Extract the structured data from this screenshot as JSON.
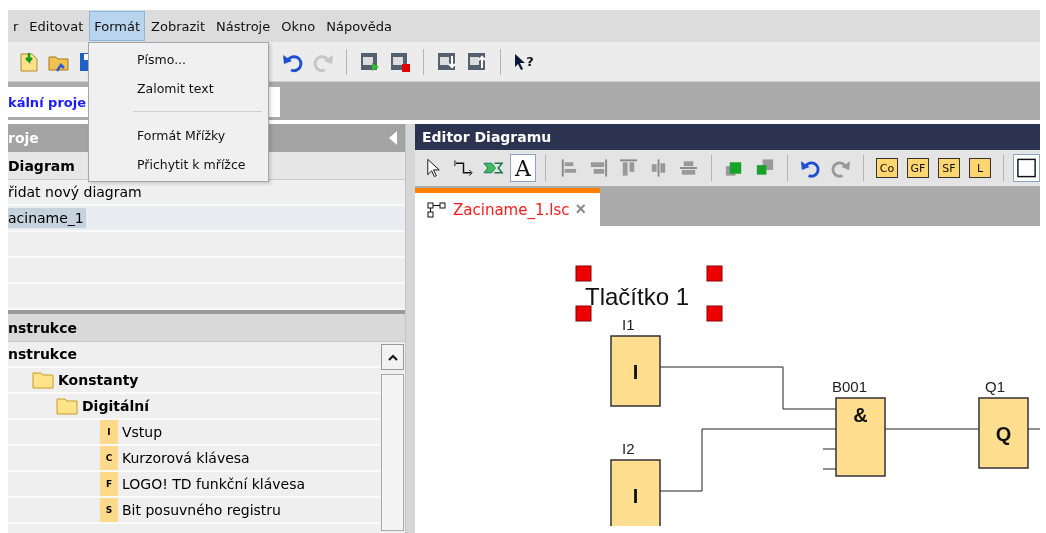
{
  "menu_bar": [
    {
      "label": "r",
      "selected": false
    },
    {
      "label": "Editovat",
      "selected": false
    },
    {
      "label": "Formát",
      "selected": true
    },
    {
      "label": "Zobrazit",
      "selected": false
    },
    {
      "label": "Nástroje",
      "selected": false
    },
    {
      "label": "Okno",
      "selected": false
    },
    {
      "label": "Nápověda",
      "selected": false
    }
  ],
  "format_menu": [
    {
      "kind": "item",
      "label": "Písmo..."
    },
    {
      "kind": "item",
      "label": "Zalomit text"
    },
    {
      "kind": "separator"
    },
    {
      "kind": "item",
      "label": "Formát Mřížky"
    },
    {
      "kind": "item",
      "label": "Přichytit k mřížce"
    }
  ],
  "main_toolbar": [
    {
      "kind": "icon",
      "enabled": true
    },
    {
      "kind": "icon",
      "enabled": true
    },
    {
      "kind": "icon",
      "enabled": true
    },
    {
      "kind": "gap"
    },
    {
      "kind": "icon",
      "enabled": true
    },
    {
      "kind": "icon",
      "enabled": false
    },
    {
      "kind": "separator"
    },
    {
      "kind": "icon",
      "enabled": true
    },
    {
      "kind": "icon",
      "enabled": true
    },
    {
      "kind": "separator"
    },
    {
      "kind": "icon",
      "enabled": true
    },
    {
      "kind": "icon",
      "enabled": true
    },
    {
      "kind": "separator"
    },
    {
      "kind": "help",
      "label": "?",
      "enabled": true
    }
  ],
  "project_tab": {
    "label": "kální proje"
  },
  "project_panel": {
    "title": "roje",
    "section": "Diagram",
    "rows": [
      {
        "label": "řidat nový diagram",
        "selected": false
      },
      {
        "label": "aciname_1",
        "selected": true
      }
    ]
  },
  "instructions_panel": {
    "title": "nstrukce",
    "tree": [
      {
        "label": "nstrukce",
        "kind": "root",
        "children": [
          {
            "label": "Konstanty",
            "kind": "folder",
            "children": [
              {
                "label": "Digitální",
                "kind": "folder",
                "children": [
                  {
                    "label": "Vstup",
                    "kind": "leaf",
                    "tag": "I"
                  },
                  {
                    "label": "Kurzorová klávesa",
                    "kind": "leaf",
                    "tag": "C"
                  },
                  {
                    "label": "LOGO! TD funkční klávesa",
                    "kind": "leaf",
                    "tag": "F"
                  },
                  {
                    "label": "Bit posuvného registru",
                    "kind": "leaf",
                    "tag": "S"
                  }
                ]
              }
            ]
          }
        ]
      }
    ]
  },
  "editor": {
    "title": "Editor Diagramu",
    "toolbar": [
      {
        "kind": "icon",
        "selected": false
      },
      {
        "kind": "icon",
        "selected": false
      },
      {
        "kind": "icon",
        "selected": false
      },
      {
        "kind": "text",
        "label": "A",
        "selected": true
      },
      {
        "kind": "separator"
      },
      {
        "kind": "icon",
        "selected": false
      },
      {
        "kind": "icon",
        "selected": false
      },
      {
        "kind": "icon",
        "selected": false
      },
      {
        "kind": "icon",
        "selected": false
      },
      {
        "kind": "icon",
        "selected": false
      },
      {
        "kind": "separator"
      },
      {
        "kind": "icon",
        "selected": false
      },
      {
        "kind": "icon",
        "selected": false
      },
      {
        "kind": "separator"
      },
      {
        "kind": "icon",
        "selected": false
      },
      {
        "kind": "icon",
        "selected": false
      },
      {
        "kind": "separator"
      },
      {
        "kind": "text",
        "label": "Co",
        "selected": false
      },
      {
        "kind": "text",
        "label": "GF",
        "selected": false
      },
      {
        "kind": "text",
        "label": "SF",
        "selected": false
      },
      {
        "kind": "text",
        "label": "L",
        "selected": false
      },
      {
        "kind": "separator"
      },
      {
        "kind": "icon",
        "selected": true
      }
    ],
    "tab": {
      "label": "Zaciname_1.lsc",
      "modified": true,
      "close": "×"
    },
    "diagram": {
      "text_label": {
        "label": "Tlačítko 1",
        "selected": true
      },
      "blocks": [
        {
          "name": "I1",
          "symbol": "I"
        },
        {
          "name": "I2",
          "symbol": "I"
        },
        {
          "name": "B001",
          "symbol": "&"
        },
        {
          "name": "Q1",
          "symbol": "Q"
        }
      ]
    }
  }
}
